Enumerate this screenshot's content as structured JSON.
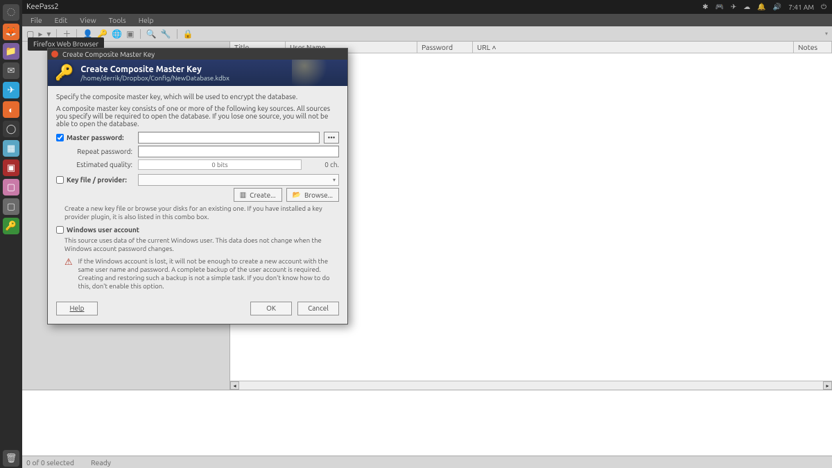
{
  "systray": {
    "app_title": "KeePass2",
    "time": "7:41 AM"
  },
  "tooltip": "Firefox Web Browser",
  "menubar": {
    "file": "File",
    "edit": "Edit",
    "view": "View",
    "tools": "Tools",
    "help": "Help"
  },
  "columns": {
    "title": "Title",
    "user": "User Name",
    "pass": "Password",
    "url": "URL ˄",
    "notes": "Notes"
  },
  "statusbar": {
    "selected": "0 of 0 selected",
    "ready": "Ready"
  },
  "dialog": {
    "titlebar": "Create Composite Master Key",
    "header_title": "Create Composite Master Key",
    "header_sub": "/home/derrik/Dropbox/Config/NewDatabase.kdbx",
    "p1": "Specify the composite master key, which will be used to encrypt the database.",
    "p2": "A composite master key consists of one or more of the following key sources. All sources you specify will be required to open the database. If you lose one source, you will not be able to open the database.",
    "master_label": "Master password:",
    "repeat_label": "Repeat password:",
    "quality_label": "Estimated quality:",
    "quality_value": "0 bits",
    "ch_count": "0 ch.",
    "keyfile_label": "Key file / provider:",
    "create_btn": "Create...",
    "browse_btn": "Browse...",
    "keyfile_desc": "Create a new key file or browse your disks for an existing one. If you have installed a key provider plugin, it is also listed in this combo box.",
    "win_label": "Windows user account",
    "win_desc": "This source uses data of the current Windows user. This data does not change when the Windows account password changes.",
    "warning": "If the Windows account is lost, it will not be enough to create a new account with the same user name and password. A complete backup of the user account is required. Creating and restoring such a backup is not a simple task. If you don't know how to do this, don't enable this option.",
    "help_btn": "Help",
    "ok_btn": "OK",
    "cancel_btn": "Cancel"
  }
}
